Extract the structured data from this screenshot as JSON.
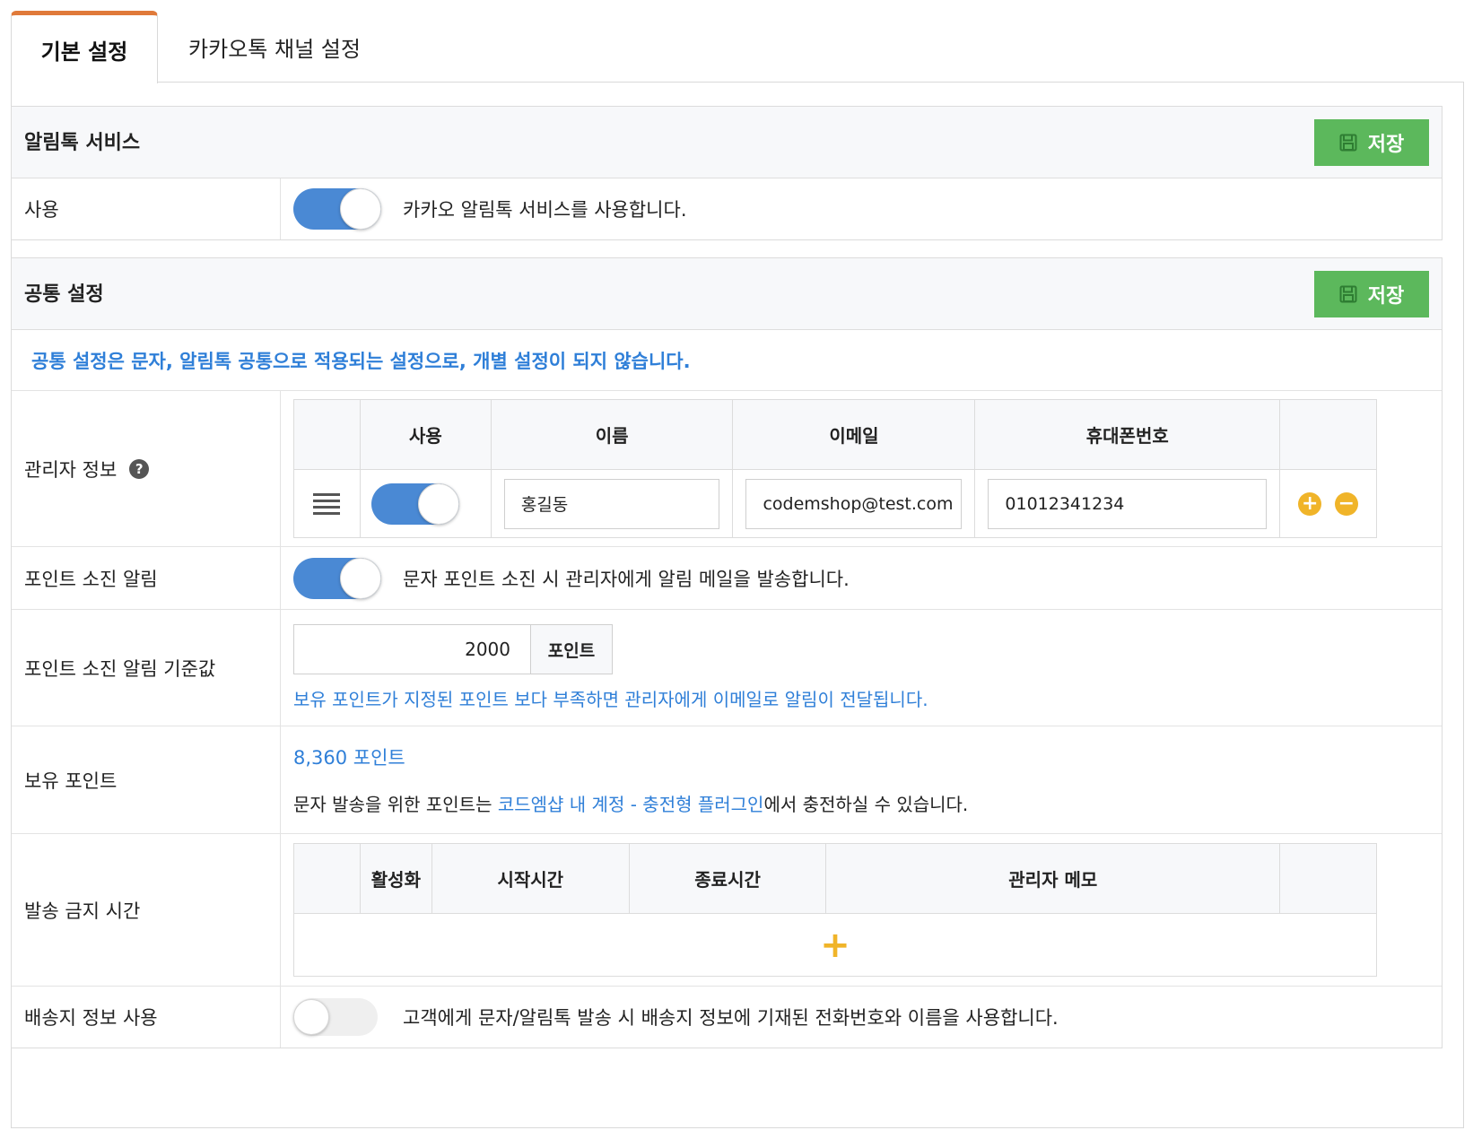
{
  "tabs": {
    "basic": "기본 설정",
    "kakao_channel": "카카오톡 채널 설정"
  },
  "alimtalk": {
    "title": "알림톡 서비스",
    "save_label": "저장",
    "use_label": "사용",
    "use_desc": "카카오 알림톡 서비스를 사용합니다."
  },
  "common": {
    "title": "공통 설정",
    "save_label": "저장",
    "notice": "공통 설정은 문자, 알림톡 공통으로 적용되는 설정으로, 개별 설정이 되지 않습니다.",
    "admin": {
      "label": "관리자 정보",
      "help": "?",
      "headers": {
        "use": "사용",
        "name": "이름",
        "email": "이메일",
        "phone": "휴대폰번호"
      },
      "rows": [
        {
          "name": "홍길동",
          "email": "codemshop@test.com",
          "phone": "01012341234"
        }
      ],
      "add": "+",
      "remove": "−"
    },
    "point_alert": {
      "label": "포인트 소진 알림",
      "desc": "문자 포인트 소진 시 관리자에게 알림 메일을 발송합니다."
    },
    "point_threshold": {
      "label": "포인트 소진 알림 기준값",
      "value": "2000",
      "unit": "포인트",
      "hint": "보유 포인트가 지정된 포인트 보다 부족하면 관리자에게 이메일로 알림이 전달됩니다."
    },
    "owned_points": {
      "label": "보유 포인트",
      "value": "8,360 포인트",
      "desc_prefix": "문자 발송을 위한 포인트는 ",
      "desc_link": "코드엠샵 내 계정 - 충전형 플러그인",
      "desc_suffix": "에서 충전하실 수 있습니다."
    },
    "blackout": {
      "label": "발송 금지 시간",
      "headers": {
        "active": "활성화",
        "start": "시작시간",
        "end": "종료시간",
        "memo": "관리자 메모"
      },
      "add": "+"
    },
    "shipping_info": {
      "label": "배송지 정보 사용",
      "desc": "고객에게 문자/알림톡 발송 시 배송지 정보에 기재된 전화번호와 이름을 사용합니다."
    }
  },
  "colors": {
    "accent_tab": "#e07a3a",
    "save_green": "#5cb85c",
    "toggle_blue": "#4a89d4",
    "link_blue": "#2f7fd8",
    "add_orange": "#f0b429"
  }
}
